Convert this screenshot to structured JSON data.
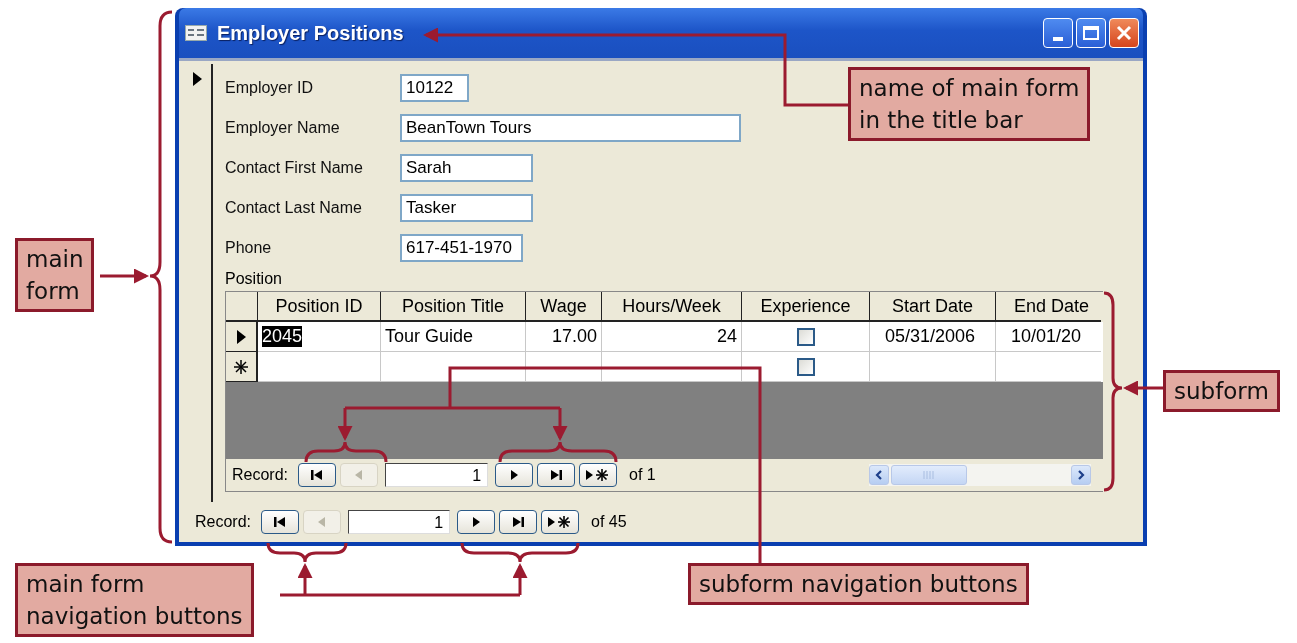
{
  "window": {
    "title": "Employer Positions"
  },
  "fields": [
    {
      "label": "Employer ID",
      "value": "10122"
    },
    {
      "label": "Employer Name",
      "value": "BeanTown Tours"
    },
    {
      "label": "Contact First Name",
      "value": "Sarah"
    },
    {
      "label": "Contact Last Name",
      "value": "Tasker"
    },
    {
      "label": "Phone",
      "value": "617-451-1970"
    }
  ],
  "subform": {
    "label": "Position",
    "columns": [
      "Position ID",
      "Position Title",
      "Wage",
      "Hours/Week",
      "Experience",
      "Start Date",
      "End Date"
    ],
    "rows": [
      {
        "kind": "current",
        "cells": [
          {
            "kind": "text",
            "text": "2045",
            "selected": true
          },
          {
            "kind": "text",
            "text": "Tour Guide",
            "selected": false
          },
          {
            "kind": "number",
            "text": "17.00",
            "selected": false
          },
          {
            "kind": "number",
            "text": "24",
            "selected": false
          },
          {
            "kind": "checkbox",
            "checked": false
          },
          {
            "kind": "date",
            "text": "05/31/2006",
            "selected": false
          },
          {
            "kind": "date",
            "text": "10/01/20",
            "selected": false
          }
        ]
      },
      {
        "kind": "new",
        "cells": [
          {
            "kind": "blank"
          },
          {
            "kind": "blank"
          },
          {
            "kind": "blank"
          },
          {
            "kind": "blank"
          },
          {
            "kind": "checkbox",
            "checked": false
          },
          {
            "kind": "blank"
          },
          {
            "kind": "blank"
          }
        ]
      }
    ],
    "navigation": {
      "label": "Record:",
      "current": "1",
      "total": "of 1",
      "buttons": [
        {
          "kind": "first",
          "disabled": false
        },
        {
          "kind": "previous",
          "disabled": true
        },
        {
          "kind": "next",
          "disabled": false
        },
        {
          "kind": "last",
          "disabled": false
        },
        {
          "kind": "new",
          "disabled": false
        }
      ]
    }
  },
  "navigation": {
    "label": "Record:",
    "current": "1",
    "total": "of 45",
    "buttons": [
      {
        "kind": "first",
        "disabled": false
      },
      {
        "kind": "previous",
        "disabled": true
      },
      {
        "kind": "next",
        "disabled": false
      },
      {
        "kind": "last",
        "disabled": false
      },
      {
        "kind": "new",
        "disabled": false
      }
    ]
  },
  "annotations": [
    {
      "kind": "main_form",
      "lines": [
        "main",
        "form"
      ]
    },
    {
      "kind": "title",
      "lines": [
        "name of main form",
        "in the title bar"
      ]
    },
    {
      "kind": "subform",
      "lines": [
        "subform"
      ]
    },
    {
      "kind": "main_nav",
      "lines": [
        "main form",
        "navigation buttons"
      ]
    },
    {
      "kind": "subform_nav",
      "lines": [
        "subform navigation buttons"
      ]
    }
  ]
}
